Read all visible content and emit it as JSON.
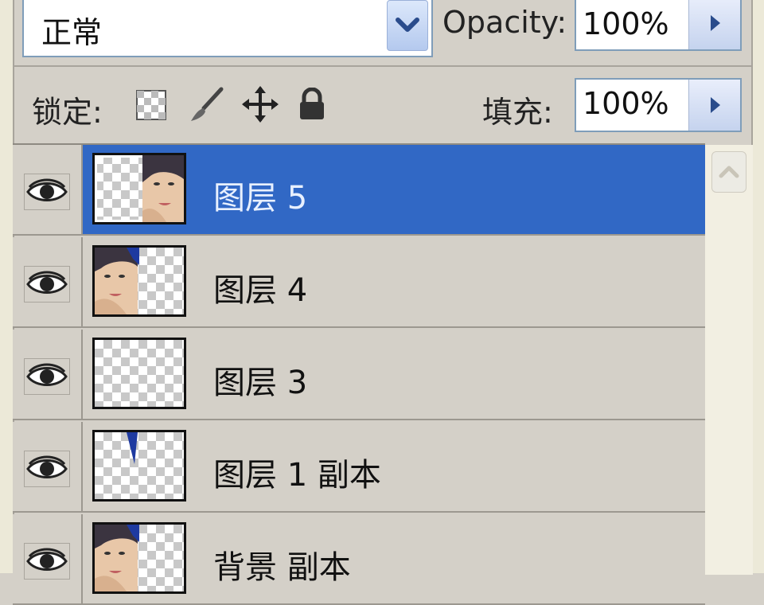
{
  "blend_mode": {
    "value": "正常"
  },
  "opacity": {
    "label": "Opacity:",
    "value": "100%"
  },
  "lock": {
    "label": "锁定:"
  },
  "fill": {
    "label": "填充:",
    "value": "100%"
  },
  "layers": [
    {
      "name": "图层 5",
      "selected": true,
      "thumb": "face-right"
    },
    {
      "name": "图层 4",
      "selected": false,
      "thumb": "face-left"
    },
    {
      "name": "图层 3",
      "selected": false,
      "thumb": "empty"
    },
    {
      "name": "图层 1 副本",
      "selected": false,
      "thumb": "blue-sliver"
    },
    {
      "name": "背景 副本",
      "selected": false,
      "thumb": "face-left"
    }
  ],
  "colors": {
    "selection": "#3168c5",
    "panel": "#d4d0c8"
  },
  "icons": [
    "chevron-down-icon",
    "triangle-right-icon",
    "lock-transparency-icon",
    "brush-icon",
    "move-icon",
    "lock-icon",
    "eye-icon",
    "scroll-up-icon"
  ]
}
